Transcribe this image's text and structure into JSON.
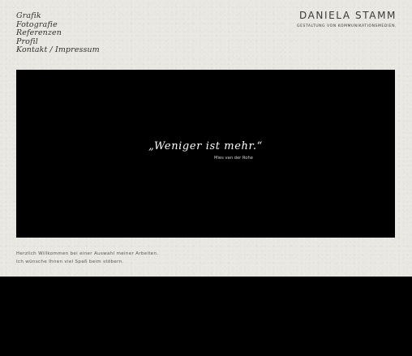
{
  "nav": {
    "items": [
      {
        "label": "Grafik"
      },
      {
        "label": "Fotografie"
      },
      {
        "label": "Referenzen"
      },
      {
        "label": "Profil"
      },
      {
        "label": "Kontakt / Impressum"
      }
    ]
  },
  "brand": {
    "name": "DANIELA STAMM",
    "tagline": "GESTALTUNG VON KOMMUNIKATIONSMEDIEN."
  },
  "hero": {
    "quote": "„Weniger ist mehr.“",
    "author": "Mies van der Rohe"
  },
  "welcome": {
    "line1": "Herzlich Willkommen bei einer Auswahl meiner Arbeiten.",
    "line2": "Ich wünsche Ihnen viel Spaß beim stöbern."
  },
  "colors": {
    "paper": "#e9e8e3",
    "ink": "#2f2f2f",
    "stage": "#000000"
  }
}
